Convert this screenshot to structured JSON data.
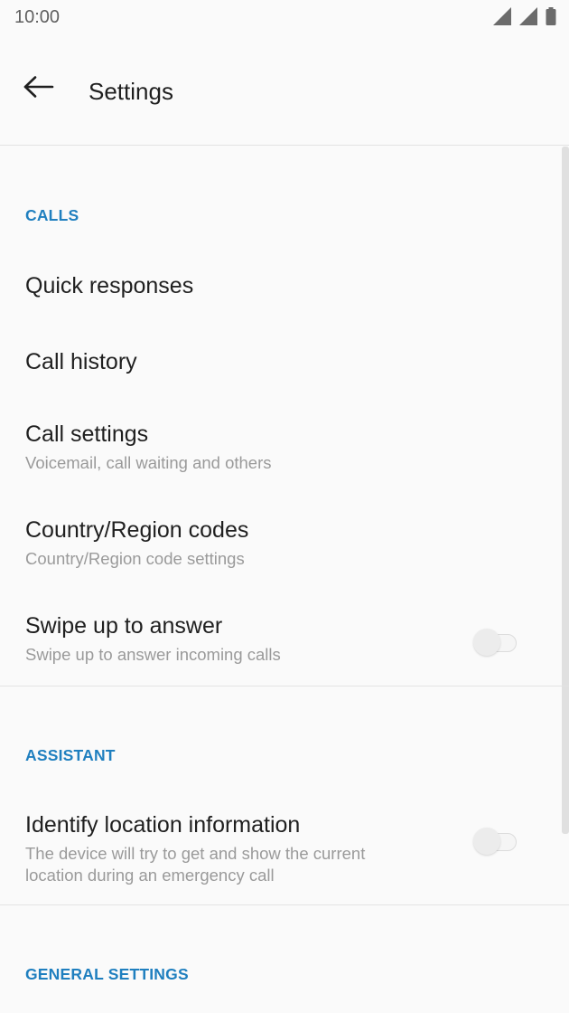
{
  "status_bar": {
    "time": "10:00",
    "icons": [
      "signal-icon",
      "signal-icon",
      "battery-icon"
    ]
  },
  "app_bar": {
    "back_icon": "arrow-back-icon",
    "title": "Settings"
  },
  "sections": {
    "calls": {
      "header": "CALLS",
      "items": [
        {
          "title": "Quick responses"
        },
        {
          "title": "Call history"
        },
        {
          "title": "Call settings",
          "summary": "Voicemail, call waiting and others"
        },
        {
          "title": "Country/Region codes",
          "summary": "Country/Region code settings"
        },
        {
          "title": "Swipe up to answer",
          "summary": "Swipe up to answer incoming calls",
          "toggle_on": false
        }
      ]
    },
    "assistant": {
      "header": "ASSISTANT",
      "items": [
        {
          "title": "Identify location information",
          "summary": "The device will try to get and show the current location during an emergency call",
          "toggle_on": false
        }
      ]
    },
    "general": {
      "header": "GENERAL SETTINGS"
    }
  },
  "colors": {
    "accent": "#1f7fbf",
    "background": "#fafafa",
    "divider": "#e3e3e3",
    "summary_text": "#9a9a9a"
  }
}
